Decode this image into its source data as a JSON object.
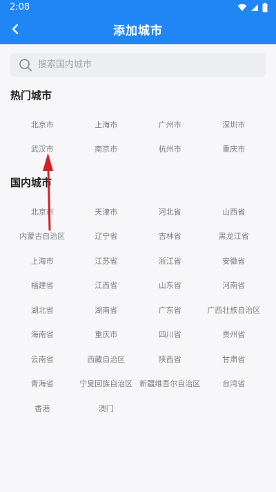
{
  "status_bar": {
    "time": "2:08"
  },
  "header": {
    "title": "添加城市"
  },
  "search": {
    "placeholder": "搜索国内城市"
  },
  "hot_cities": {
    "title": "热门城市",
    "items": [
      "北京市",
      "上海市",
      "广州市",
      "深圳市",
      "武汉市",
      "南京市",
      "杭州市",
      "重庆市"
    ]
  },
  "domestic_cities": {
    "title": "国内城市",
    "items": [
      "北京市",
      "天津市",
      "河北省",
      "山西省",
      "内蒙古自治区",
      "辽宁省",
      "吉林省",
      "黑龙江省",
      "上海市",
      "江苏省",
      "浙江省",
      "安徽省",
      "福建省",
      "江西省",
      "山东省",
      "河南省",
      "湖北省",
      "湖南省",
      "广东省",
      "广西壮族自治区",
      "海南省",
      "重庆市",
      "四川省",
      "贵州省",
      "云南省",
      "西藏自治区",
      "陕西省",
      "甘肃省",
      "青海省",
      "宁夏回族自治区",
      "新疆维吾尔自治区",
      "台湾省",
      "香港",
      "澳门"
    ]
  },
  "colors": {
    "header": "#2086f6",
    "annotation_arrow": "#d61f26"
  }
}
